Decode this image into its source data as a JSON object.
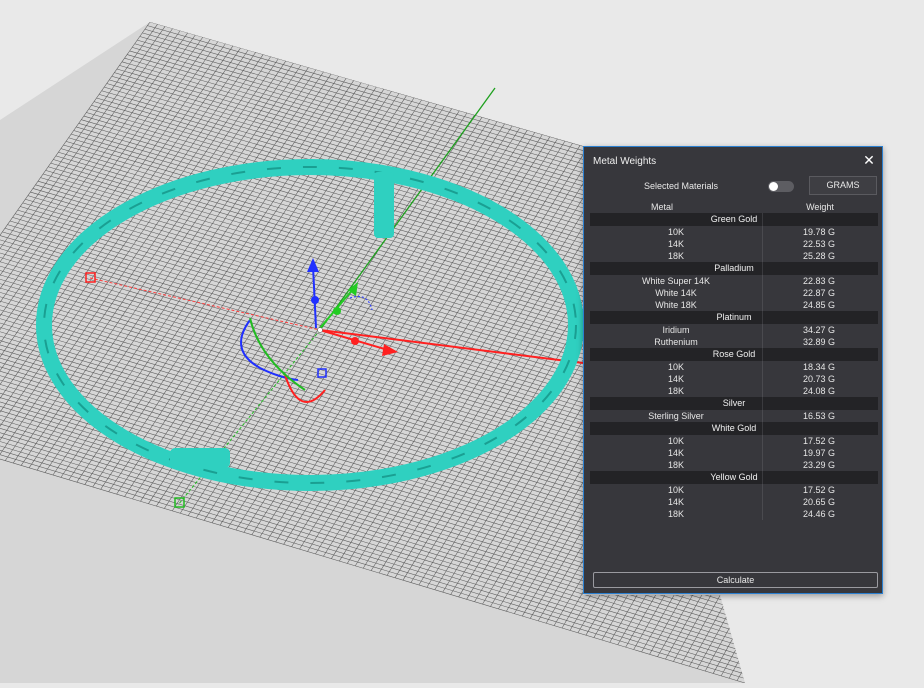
{
  "panel": {
    "title": "Metal Weights",
    "selected_materials_label": "Selected Materials",
    "unit_button": "GRAMS",
    "columns": {
      "metal": "Metal",
      "weight": "Weight"
    },
    "calculate_label": "Calculate",
    "groups": [
      {
        "name": "Green Gold",
        "rows": [
          {
            "metal": "10K",
            "weight": "19.78 G"
          },
          {
            "metal": "14K",
            "weight": "22.53 G"
          },
          {
            "metal": "18K",
            "weight": "25.28 G"
          }
        ]
      },
      {
        "name": "Palladium",
        "rows": [
          {
            "metal": "White Super 14K",
            "weight": "22.83 G"
          },
          {
            "metal": "White 14K",
            "weight": "22.87 G"
          },
          {
            "metal": "White 18K",
            "weight": "24.85 G"
          }
        ]
      },
      {
        "name": "Platinum",
        "rows": [
          {
            "metal": "Iridium",
            "weight": "34.27 G"
          },
          {
            "metal": "Ruthenium",
            "weight": "32.89 G"
          }
        ]
      },
      {
        "name": "Rose Gold",
        "rows": [
          {
            "metal": "10K",
            "weight": "18.34 G"
          },
          {
            "metal": "14K",
            "weight": "20.73 G"
          },
          {
            "metal": "18K",
            "weight": "24.08 G"
          }
        ]
      },
      {
        "name": "Silver",
        "rows": [
          {
            "metal": "Sterling Silver",
            "weight": "16.53 G"
          }
        ]
      },
      {
        "name": "White Gold",
        "rows": [
          {
            "metal": "10K",
            "weight": "17.52 G"
          },
          {
            "metal": "14K",
            "weight": "19.97 G"
          },
          {
            "metal": "18K",
            "weight": "23.29 G"
          }
        ]
      },
      {
        "name": "Yellow Gold",
        "rows": [
          {
            "metal": "10K",
            "weight": "17.52 G"
          },
          {
            "metal": "14K",
            "weight": "20.65 G"
          },
          {
            "metal": "18K",
            "weight": "24.46 G"
          }
        ]
      }
    ]
  },
  "colors": {
    "model": "#2fd0c0",
    "x_axis": "#ff2020",
    "y_axis": "#22bb22",
    "z_axis": "#2030ff",
    "panel_bg": "#37373c",
    "panel_border": "#2a7fd0"
  },
  "icons": {
    "close": "close-icon",
    "toggle": "toggle-switch"
  }
}
